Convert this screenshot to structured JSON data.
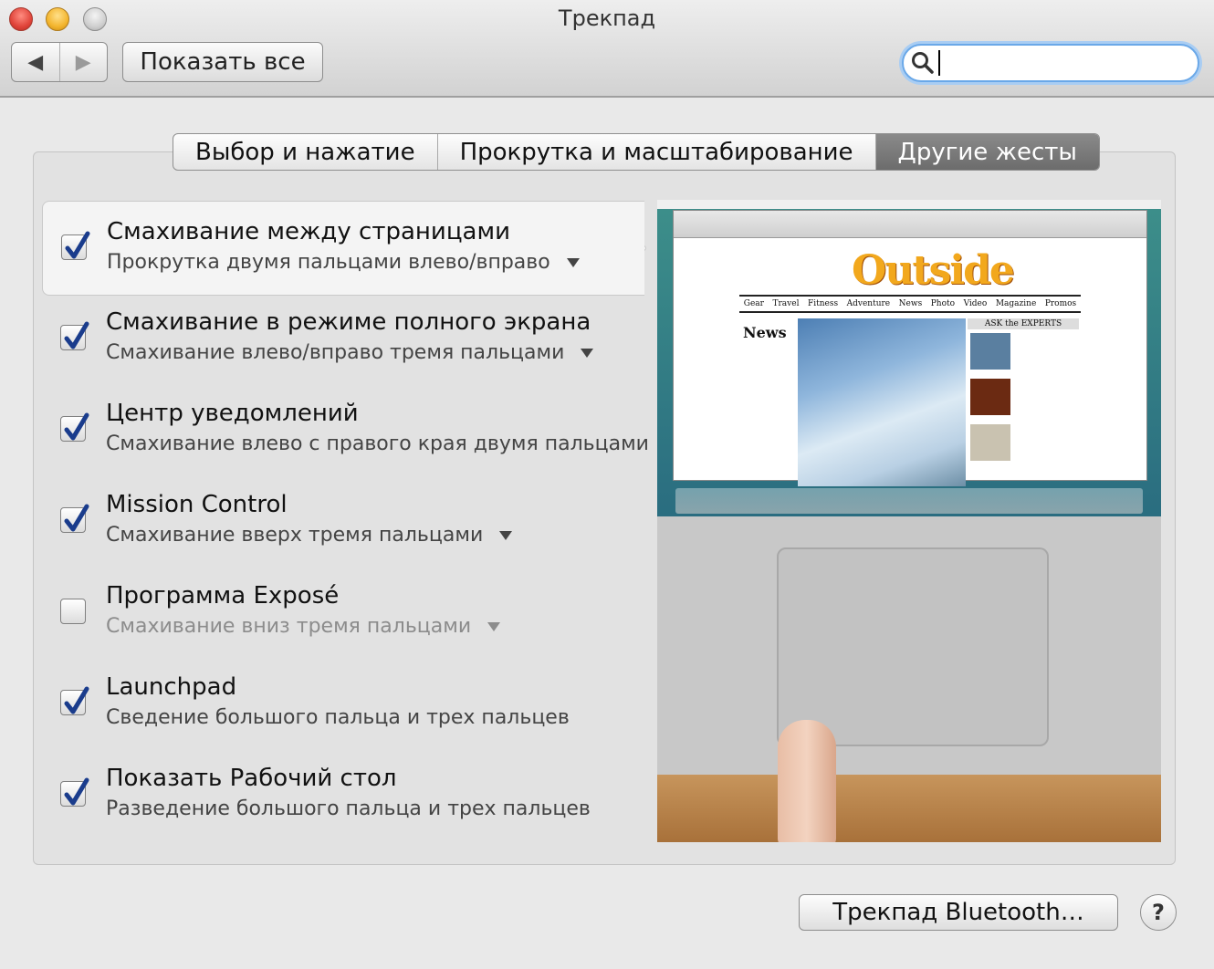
{
  "window": {
    "title": "Трекпад",
    "show_all_label": "Показать все",
    "back_glyph": "◀",
    "forward_glyph": "▶",
    "search_placeholder": ""
  },
  "tabs": [
    {
      "label": "Выбор и нажатие",
      "active": false
    },
    {
      "label": "Прокрутка и масштабирование",
      "active": false
    },
    {
      "label": "Другие жесты",
      "active": true
    }
  ],
  "gestures": [
    {
      "title": "Смахивание между страницами",
      "subtitle": "Прокрутка двумя пальцами влево/вправо",
      "checked": true,
      "has_dropdown": true,
      "selected": true
    },
    {
      "title": "Смахивание в режиме полного экрана",
      "subtitle": "Смахивание влево/вправо тремя пальцами",
      "checked": true,
      "has_dropdown": true
    },
    {
      "title": "Центр уведомлений",
      "subtitle": "Смахивание влево с правого края двумя пальцами",
      "checked": true,
      "has_dropdown": false
    },
    {
      "title": "Mission Control",
      "subtitle": "Смахивание вверх тремя пальцами",
      "checked": true,
      "has_dropdown": true
    },
    {
      "title": "Программа Exposé",
      "subtitle": "Смахивание вниз тремя пальцами",
      "checked": false,
      "has_dropdown": true
    },
    {
      "title": "Launchpad",
      "subtitle": "Сведение большого пальца и трех пальцев",
      "checked": true,
      "has_dropdown": false
    },
    {
      "title": "Показать Рабочий стол",
      "subtitle": "Разведение большого пальца и трех пальцев",
      "checked": true,
      "has_dropdown": false
    }
  ],
  "preview": {
    "site_logo": "Outside",
    "nav": [
      "Gear",
      "Travel",
      "Fitness",
      "Adventure",
      "News",
      "Photo",
      "Video",
      "Magazine",
      "Promos"
    ],
    "news_header": "News",
    "experts_header": "ASK the EXPERTS"
  },
  "footer": {
    "bluetooth_button": "Трекпад Bluetooth…",
    "help_glyph": "?"
  },
  "colors": {
    "checkbox_check": "#1a3c8c",
    "active_tab": "#6f6f6f",
    "search_focus": "#6aa8e8"
  }
}
